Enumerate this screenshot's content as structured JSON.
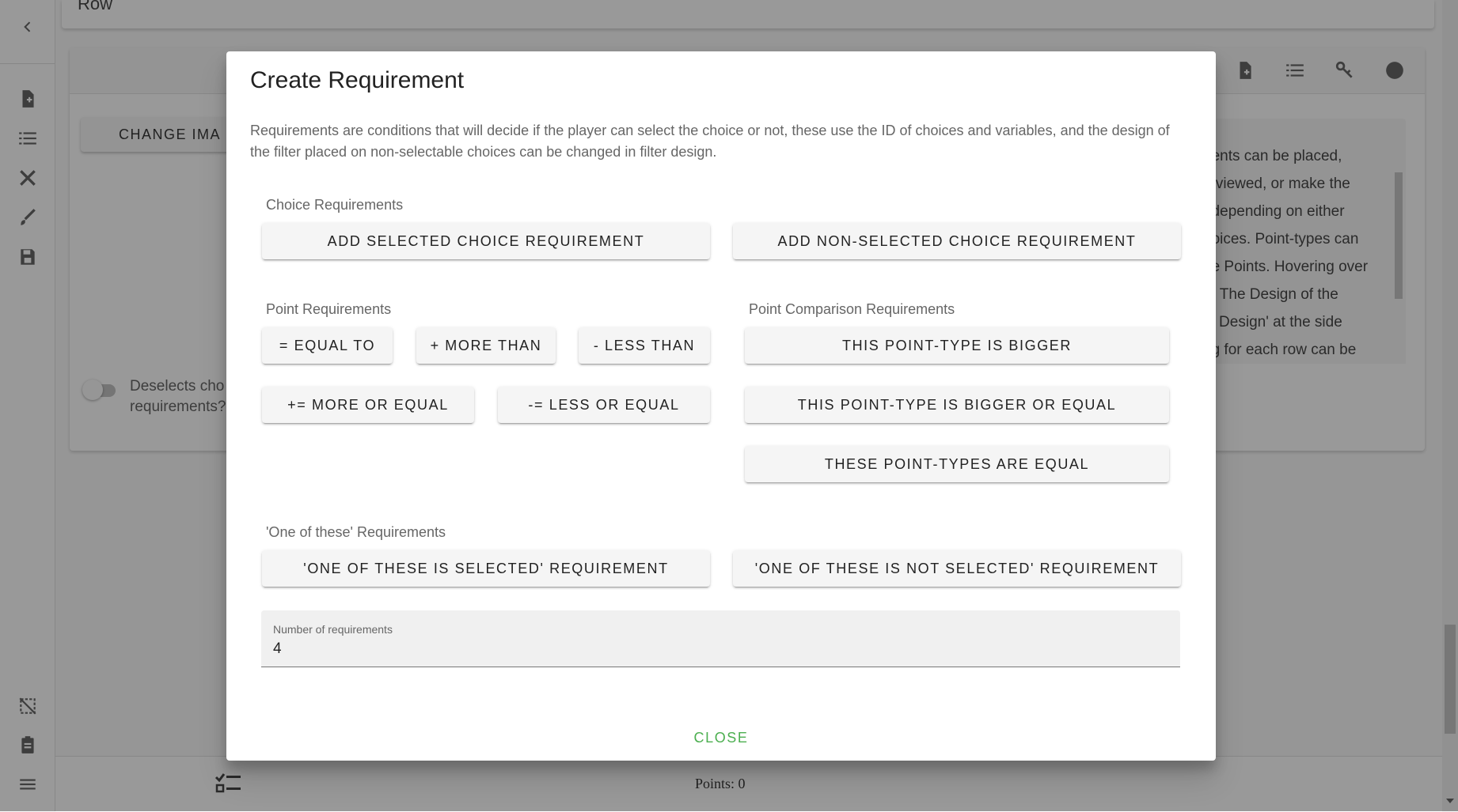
{
  "background": {
    "top_row_title": "Row",
    "change_image_label": "CHANGE IMA",
    "description_lines": [
      "nents can be placed,",
      "g viewed, or make the",
      ", depending on either",
      "hoices. Point-types can",
      "ge Points. Hovering over",
      "p. The Design of the",
      "fy Design' at the side",
      "ng for each row can be"
    ],
    "toggle_label_line1": "Deselects cho",
    "toggle_label_line2": "requirements?",
    "points_text": "Points: 0"
  },
  "dialog": {
    "title": "Create Requirement",
    "intro": "Requirements are conditions that will decide if the player can select the choice or not, these use the ID of choices and variables, and the design of the filter placed on non-selectable choices can be changed in filter design.",
    "choice_section": {
      "label": "Choice Requirements",
      "add_selected": "ADD SELECTED CHOICE REQUIREMENT",
      "add_non_selected": "ADD NON-SELECTED CHOICE REQUIREMENT"
    },
    "point_section": {
      "label": "Point Requirements",
      "equal_to": "= EQUAL TO",
      "more_than": "+ MORE THAN",
      "less_than": "- LESS THAN",
      "more_or_equal": "+= MORE OR EQUAL",
      "less_or_equal": "-= LESS OR EQUAL"
    },
    "comparison_section": {
      "label": "Point Comparison Requirements",
      "bigger": "THIS POINT-TYPE IS BIGGER",
      "bigger_or_equal": "THIS POINT-TYPE IS BIGGER OR EQUAL",
      "equal": "THESE POINT-TYPES ARE EQUAL"
    },
    "one_of_section": {
      "label": "'One of these' Requirements",
      "selected": "'ONE OF THESE IS SELECTED' REQUIREMENT",
      "not_selected": "'ONE OF THESE IS NOT SELECTED' REQUIREMENT"
    },
    "number_field": {
      "label": "Number of requirements",
      "value": "4"
    },
    "close_label": "CLOSE"
  }
}
